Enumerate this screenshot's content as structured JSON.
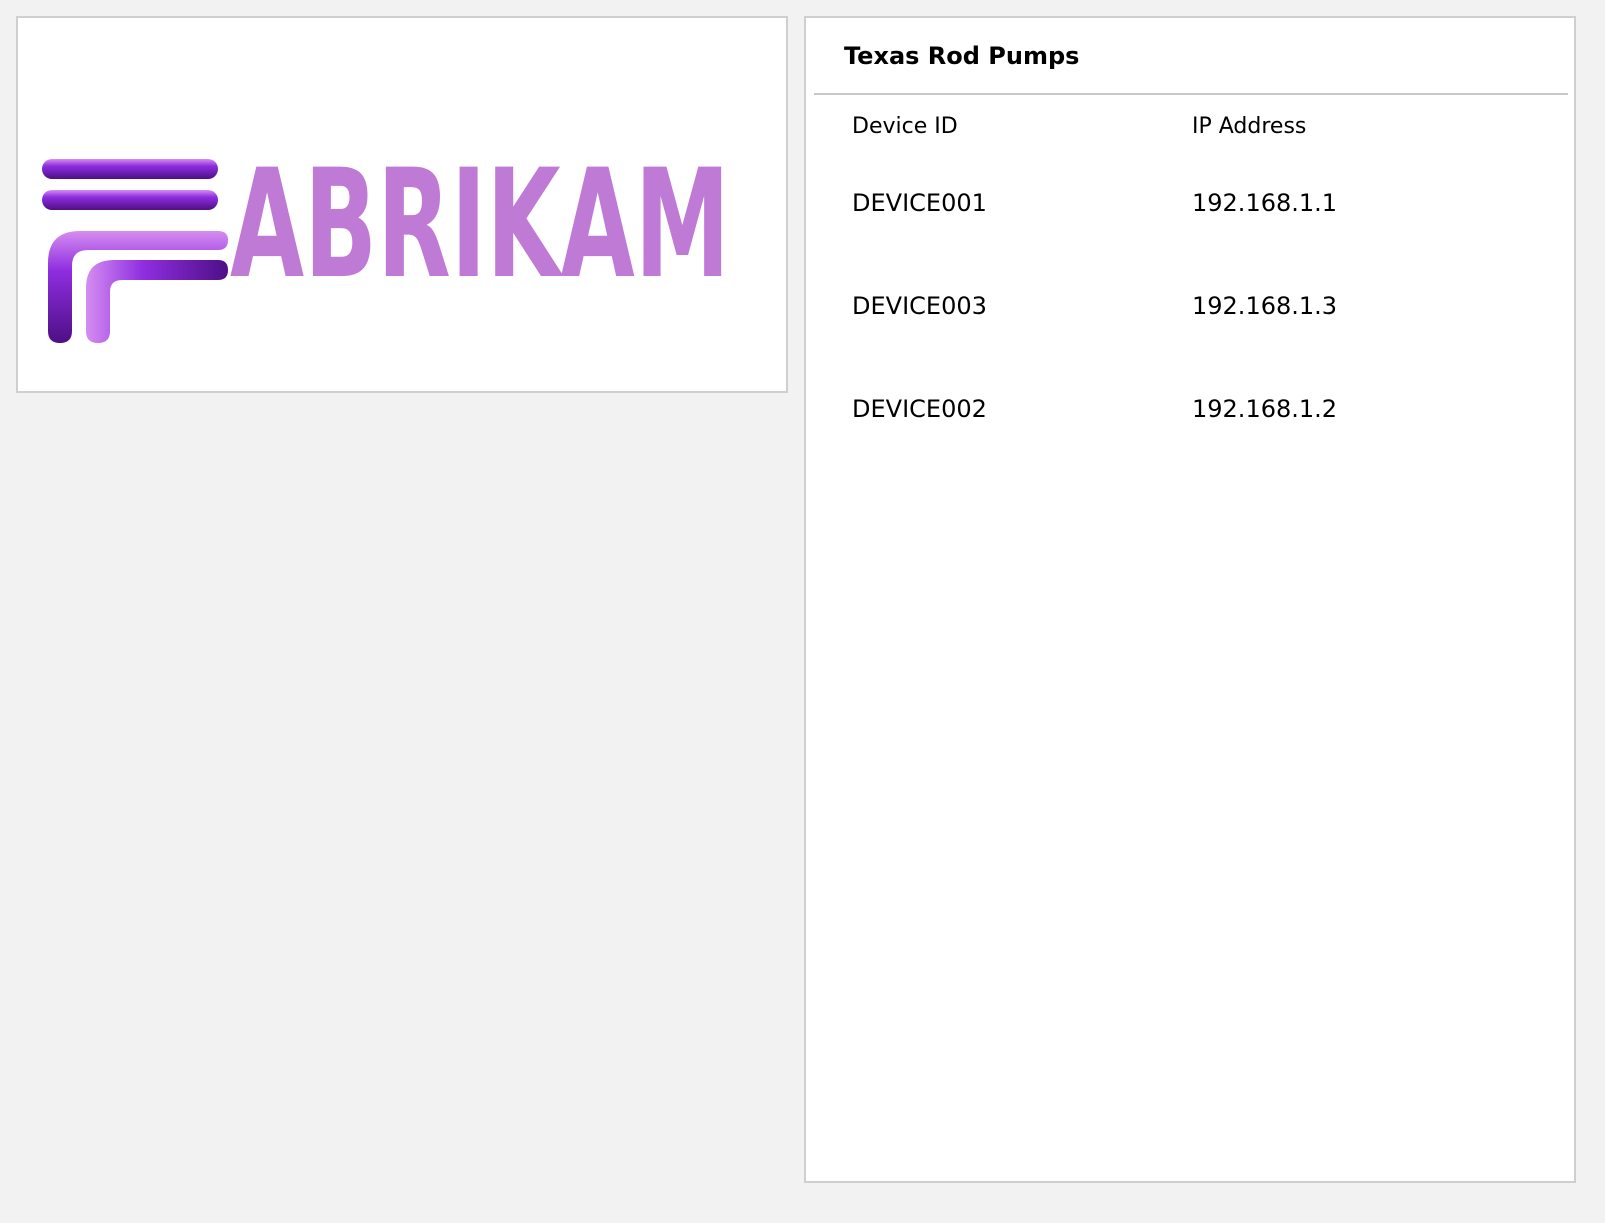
{
  "logo": {
    "text": "ABRIKAM",
    "wordmark_color": "#bf7ad6",
    "bar_color": "#7a1fc7"
  },
  "panel": {
    "title": "Texas Rod Pumps"
  },
  "table": {
    "headers": {
      "device_id": "Device ID",
      "ip_address": "IP Address"
    },
    "rows": [
      {
        "device_id": "DEVICE001",
        "ip_address": "192.168.1.1"
      },
      {
        "device_id": "DEVICE003",
        "ip_address": "192.168.1.3"
      },
      {
        "device_id": "DEVICE002",
        "ip_address": "192.168.1.2"
      }
    ]
  }
}
